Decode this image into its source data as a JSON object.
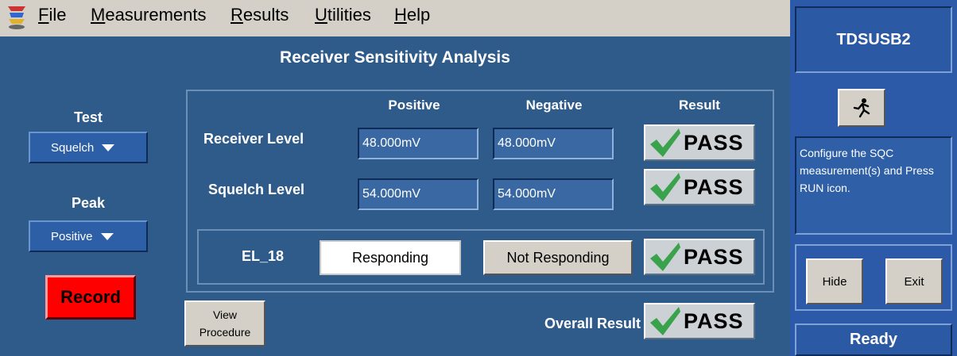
{
  "menu": {
    "items": [
      {
        "key": "F",
        "rest": "ile"
      },
      {
        "key": "M",
        "rest": "easurements"
      },
      {
        "key": "R",
        "rest": "esults"
      },
      {
        "key": "U",
        "rest": "tilities"
      },
      {
        "key": "H",
        "rest": "elp"
      }
    ]
  },
  "main": {
    "title": "Receiver Sensitivity Analysis",
    "test_label": "Test",
    "test_value": "Squelch",
    "peak_label": "Peak",
    "peak_value": "Positive",
    "record_label": "Record",
    "columns": {
      "positive": "Positive",
      "negative": "Negative",
      "result": "Result"
    },
    "rows": [
      {
        "label": "Receiver Level",
        "positive": "48.000mV",
        "negative": "48.000mV",
        "result": "PASS"
      },
      {
        "label": "Squelch Level",
        "positive": "54.000mV",
        "negative": "54.000mV",
        "result": "PASS"
      }
    ],
    "el18": {
      "label": "EL_18",
      "responding": "Responding",
      "not_responding": "Not Responding",
      "result": "PASS"
    },
    "view_procedure": {
      "line1": "View",
      "line2": "Procedure"
    },
    "overall_label": "Overall Result",
    "overall_result": "PASS"
  },
  "right": {
    "title": "TDSUSB2",
    "message": "Configure the SQC measurement(s) and Press RUN icon.",
    "hide_label": "Hide",
    "exit_label": "Exit",
    "status": "Ready"
  },
  "colors": {
    "panel": "#2e5b8a",
    "record": "#ff0000",
    "pass_check": "#3aa24a"
  }
}
